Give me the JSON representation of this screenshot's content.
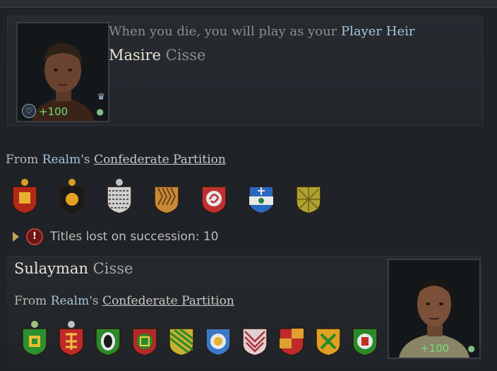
{
  "heir": {
    "intro_prefix": "When you die, you will play as your ",
    "intro_link": "Player Heir",
    "first_name": "Masire",
    "dynasty": "Cisse",
    "opinion": "+100"
  },
  "heir_realm": {
    "from": "From ",
    "realm": "Realm",
    "possessive": "'s ",
    "partition": "Confederate Partition"
  },
  "succession": {
    "label": "Titles lost on succession: 10"
  },
  "second": {
    "first_name": "Sulayman",
    "dynasty": "Cisse",
    "opinion": "+100",
    "from": "From ",
    "realm": "Realm",
    "possessive": "'s ",
    "partition": "Confederate Partition"
  },
  "colors": {
    "accent_blue": "#a8c4d8",
    "opinion_green": "#6fe26f",
    "warning_red": "#c23a3a"
  }
}
